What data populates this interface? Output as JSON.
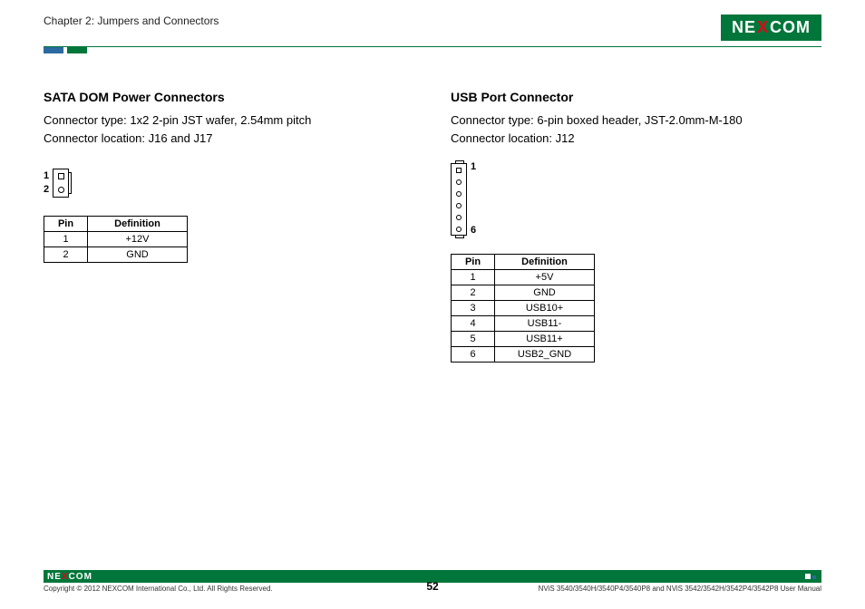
{
  "header": {
    "chapter": "Chapter 2: Jumpers and Connectors",
    "brand_left": "NE",
    "brand_x": "X",
    "brand_right": "COM"
  },
  "left": {
    "title": "SATA DOM Power Connectors",
    "type_line": "Connector type: 1x2 2-pin JST wafer, 2.54mm pitch",
    "loc_line": "Connector location: J16 and J17",
    "pin_labels": {
      "p1": "1",
      "p2": "2"
    },
    "table": {
      "head_pin": "Pin",
      "head_def": "Definition",
      "rows": [
        {
          "pin": "1",
          "def": "+12V"
        },
        {
          "pin": "2",
          "def": "GND"
        }
      ]
    }
  },
  "right": {
    "title": "USB Port Connector",
    "type_line": "Connector type: 6-pin boxed header,  JST-2.0mm-M-180",
    "loc_line": "Connector location: J12",
    "pin_labels": {
      "top": "1",
      "bot": "6"
    },
    "table": {
      "head_pin": "Pin",
      "head_def": "Definition",
      "rows": [
        {
          "pin": "1",
          "def": "+5V"
        },
        {
          "pin": "2",
          "def": "GND"
        },
        {
          "pin": "3",
          "def": "USB10+"
        },
        {
          "pin": "4",
          "def": "USB11-"
        },
        {
          "pin": "5",
          "def": "USB11+"
        },
        {
          "pin": "6",
          "def": "USB2_GND"
        }
      ]
    }
  },
  "footer": {
    "brand_left": "NE",
    "brand_x": "X",
    "brand_right": "COM",
    "copyright": "Copyright © 2012 NEXCOM International Co., Ltd. All Rights Reserved.",
    "manual": "NViS 3540/3540H/3540P4/3540P8 and NViS 3542/3542H/3542P4/3542P8 User Manual",
    "page": "52"
  }
}
